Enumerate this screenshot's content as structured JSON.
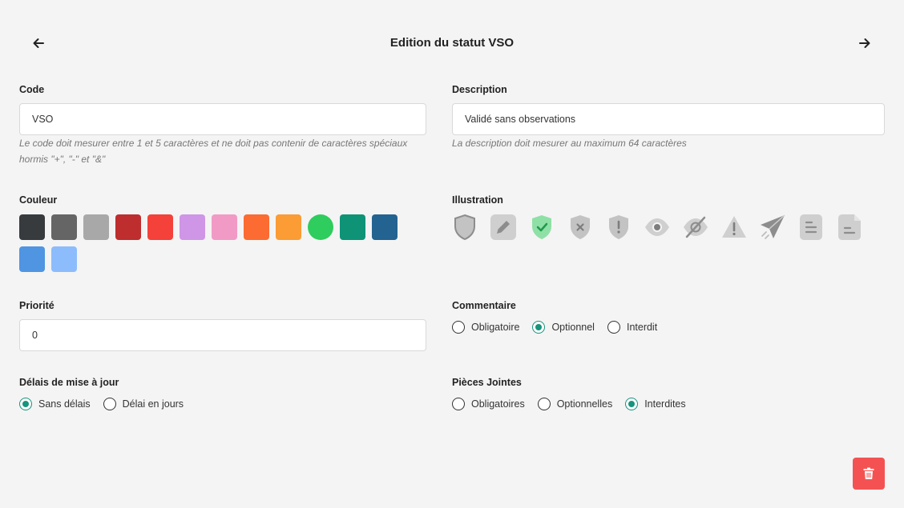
{
  "header": {
    "title": "Edition du statut VSO",
    "back_icon": "arrow-left-icon",
    "forward_icon": "arrow-right-icon"
  },
  "code": {
    "label": "Code",
    "value": "VSO",
    "hint_line1": "Le code doit mesurer entre 1 et 5 caractères et ne doit pas contenir de caractères spéciaux",
    "hint_line2": "hormis \"+\", \"-\" et \"&\""
  },
  "description": {
    "label": "Description",
    "value": "Validé sans observations",
    "hint": "La description doit mesurer au maximum 64 caractères"
  },
  "couleur": {
    "label": "Couleur",
    "selected_index": 9,
    "colors": [
      "#373b3e",
      "#656565",
      "#a8a8a8",
      "#be2e2e",
      "#f4413a",
      "#cf95e7",
      "#f29ac6",
      "#fc6b31",
      "#fb9c34",
      "#2fcc5e",
      "#0e9377",
      "#236391",
      "#4f95e2",
      "#8dbcfd"
    ]
  },
  "illustration": {
    "label": "Illustration",
    "selected_index": 2,
    "icons": [
      "shield-icon",
      "pencil-icon",
      "shield-check-icon",
      "shield-x-icon",
      "shield-exclamation-icon",
      "eye-icon",
      "eye-slash-icon",
      "warning-triangle-icon",
      "paper-plane-icon",
      "document-lines-icon",
      "document-corner-icon"
    ]
  },
  "priorite": {
    "label": "Priorité",
    "value": "0"
  },
  "commentaire": {
    "label": "Commentaire",
    "options": [
      "Obligatoire",
      "Optionnel",
      "Interdit"
    ],
    "selected": "Optionnel"
  },
  "delais": {
    "label": "Délais de mise à jour",
    "options": [
      "Sans délais",
      "Délai en jours"
    ],
    "selected": "Sans délais"
  },
  "pieces_jointes": {
    "label": "Pièces Jointes",
    "options": [
      "Obligatoires",
      "Optionnelles",
      "Interdites"
    ],
    "selected": "Interdites"
  },
  "actions": {
    "delete_icon": "trash-icon",
    "delete_color": "#f45252"
  }
}
